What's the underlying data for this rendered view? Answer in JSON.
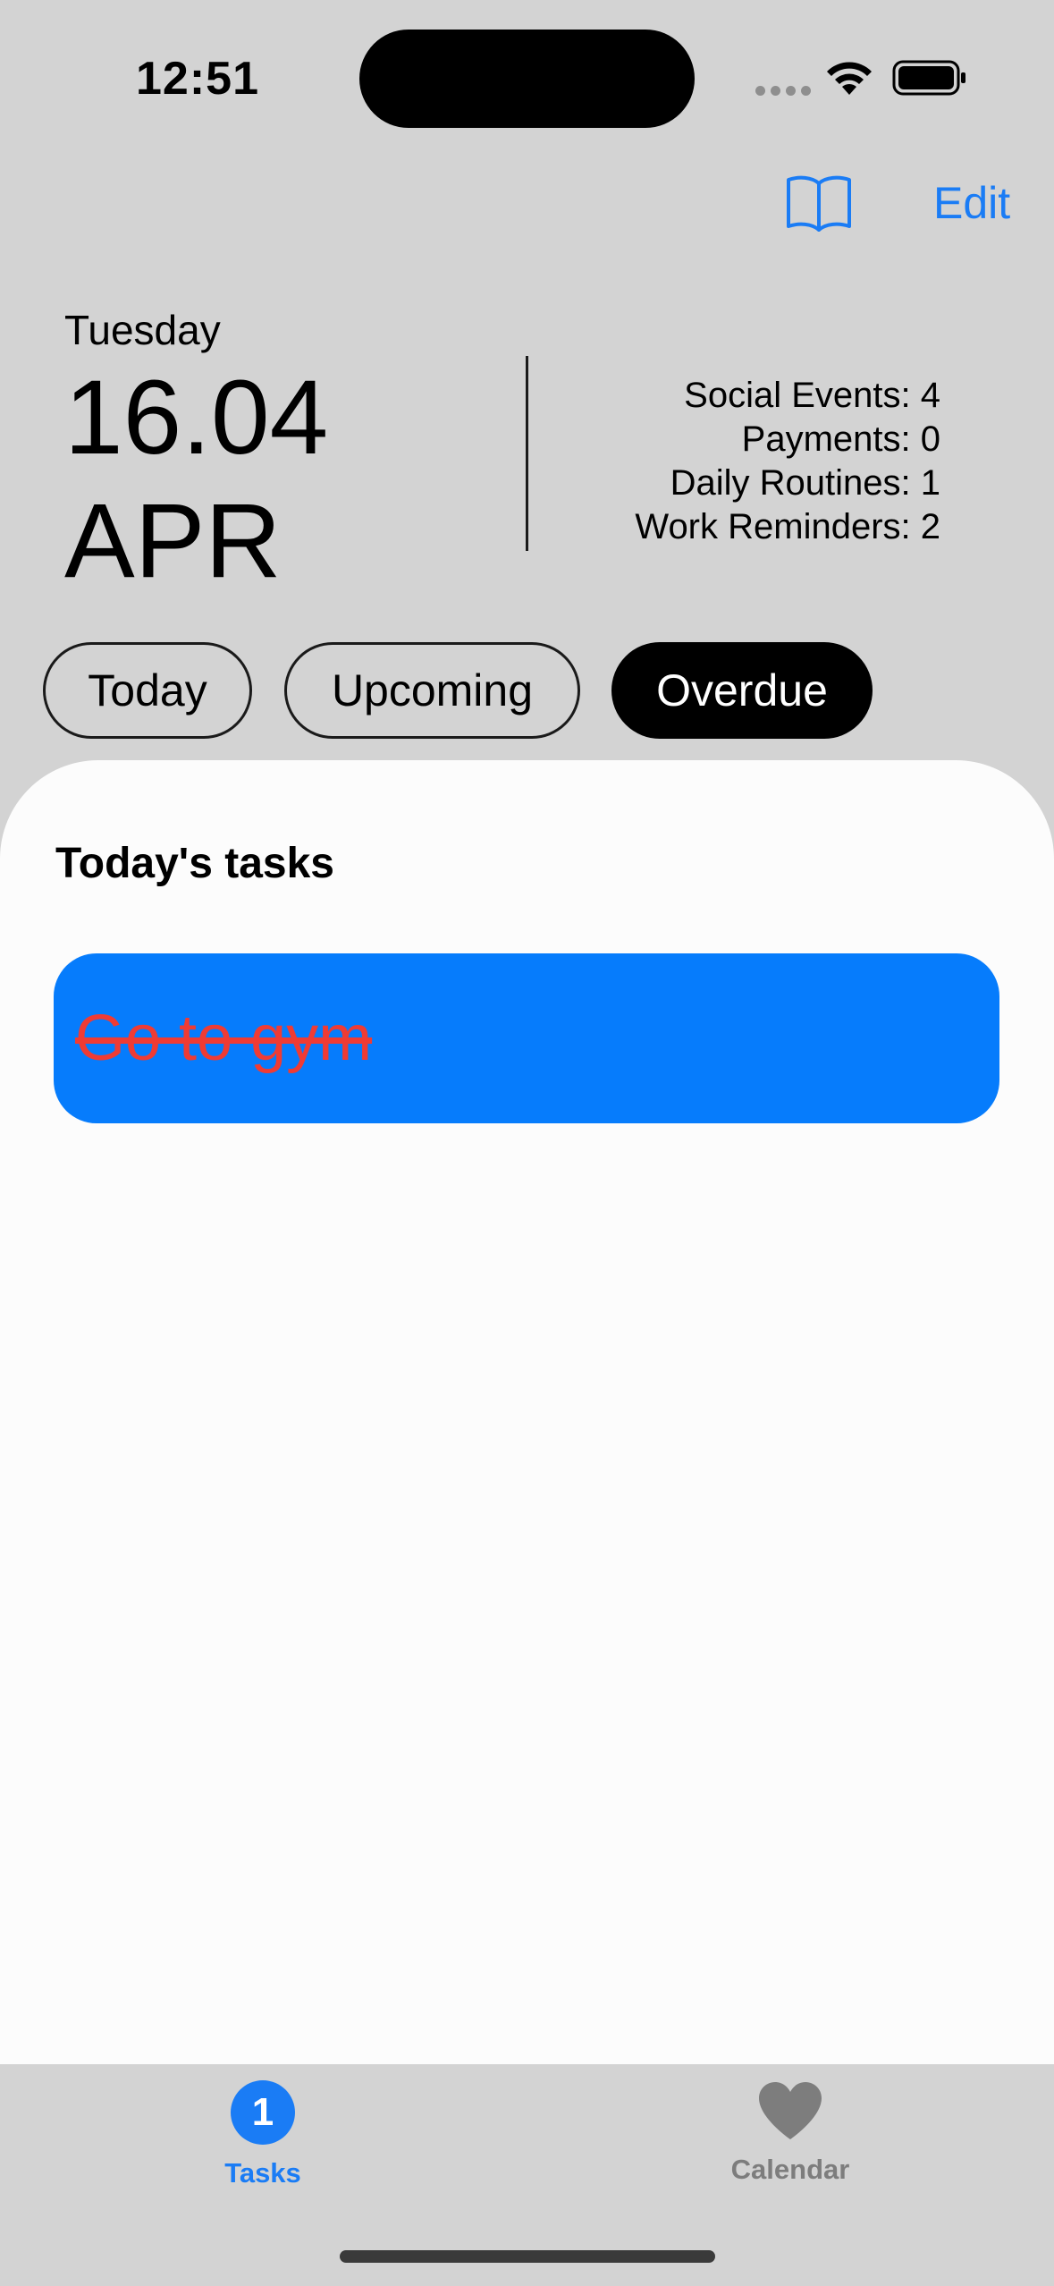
{
  "status_bar": {
    "time": "12:51"
  },
  "header": {
    "edit_label": "Edit",
    "book_icon": "book-icon"
  },
  "date": {
    "weekday": "Tuesday",
    "day": "16.04",
    "month": "APR"
  },
  "counts": [
    {
      "label": "Social Events: 4"
    },
    {
      "label": "Payments: 0"
    },
    {
      "label": "Daily Routines: 1"
    },
    {
      "label": "Work Reminders: 2"
    }
  ],
  "filters": {
    "today": "Today",
    "upcoming": "Upcoming",
    "overdue": "Overdue",
    "selected": "Overdue"
  },
  "tasks_section": {
    "title": "Today's tasks",
    "items": [
      {
        "text": "Go to gym",
        "completed": true
      }
    ]
  },
  "tabbar": {
    "tasks_label": "Tasks",
    "tasks_badge": "1",
    "calendar_label": "Calendar",
    "calendar_icon": "heart-icon"
  },
  "colors": {
    "accent": "#1a7cf5",
    "task_card": "#067cfc",
    "task_text": "#ef3b34",
    "background": "#d3d3d3",
    "sheet": "#fcfcfc"
  }
}
